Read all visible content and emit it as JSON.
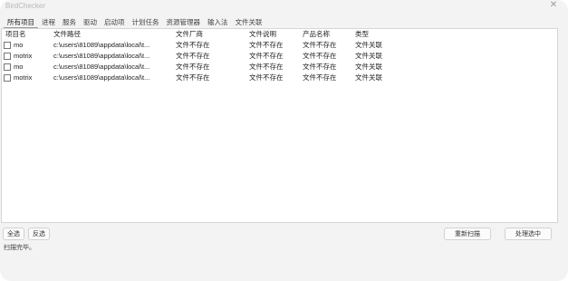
{
  "window": {
    "title": "BirdChecker",
    "close_glyph": "✕"
  },
  "tabs": [
    "所有项目",
    "进程",
    "服务",
    "驱动",
    "启动项",
    "计划任务",
    "资源管理器",
    "输入法",
    "文件关联"
  ],
  "list": {
    "columns": [
      "项目名",
      "文件路径",
      "文件厂商",
      "文件说明",
      "产品名称",
      "类型"
    ],
    "rows": [
      [
        "mo",
        "c:\\users\\81089\\appdata\\local\\t...",
        "文件不存在",
        "文件不存在",
        "文件不存在",
        "文件关联"
      ],
      [
        "motrix",
        "c:\\users\\81089\\appdata\\local\\t...",
        "文件不存在",
        "文件不存在",
        "文件不存在",
        "文件关联"
      ],
      [
        "mo",
        "c:\\users\\81089\\appdata\\local\\t...",
        "文件不存在",
        "文件不存在",
        "文件不存在",
        "文件关联"
      ],
      [
        "motrix",
        "c:\\users\\81089\\appdata\\local\\t...",
        "文件不存在",
        "文件不存在",
        "文件不存在",
        "文件关联"
      ]
    ]
  },
  "buttons": {
    "select_all": "全选",
    "invert": "反选",
    "rescan": "重新扫描",
    "process_selected": "处理选中"
  },
  "status": "扫描完毕。"
}
